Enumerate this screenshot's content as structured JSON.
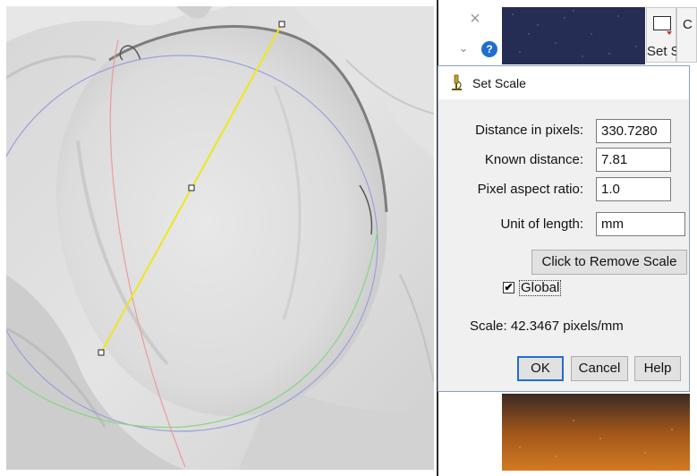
{
  "dialog": {
    "title": "Set Scale",
    "distance_in_pixels_label": "Distance in pixels:",
    "distance_in_pixels_value": "330.7280",
    "known_distance_label": "Known distance:",
    "known_distance_value": "7.81",
    "pixel_aspect_ratio_label": "Pixel aspect ratio:",
    "pixel_aspect_ratio_value": "1.0",
    "unit_of_length_label": "Unit of length:",
    "unit_of_length_value": "mm",
    "remove_scale_label": "Click to Remove Scale",
    "global_label": "Global",
    "global_checked": true,
    "scale_text": "Scale: 42.3467 pixels/mm",
    "ok_label": "OK",
    "cancel_label": "Cancel",
    "help_label": "Help"
  },
  "toolbar": {
    "set_scale_label": "Set Sc",
    "second_tool_label": "C",
    "close_glyph": "×",
    "chevron_glyph": "⌄",
    "help_glyph": "?"
  },
  "icons": {
    "close": "close-icon",
    "chevron": "chevron-down-icon",
    "help": "help-icon",
    "microscope": "microscope-icon",
    "rectangle_tool": "rectangle-tool-icon"
  },
  "colors": {
    "measure_line": "#f0e61e",
    "circle_blue": "#9aa0dc",
    "circle_green": "#88d488",
    "curve_pink": "#ee9a9a",
    "dialog_bg": "#f0f0f0",
    "accent_blue": "#1f6fd0"
  }
}
